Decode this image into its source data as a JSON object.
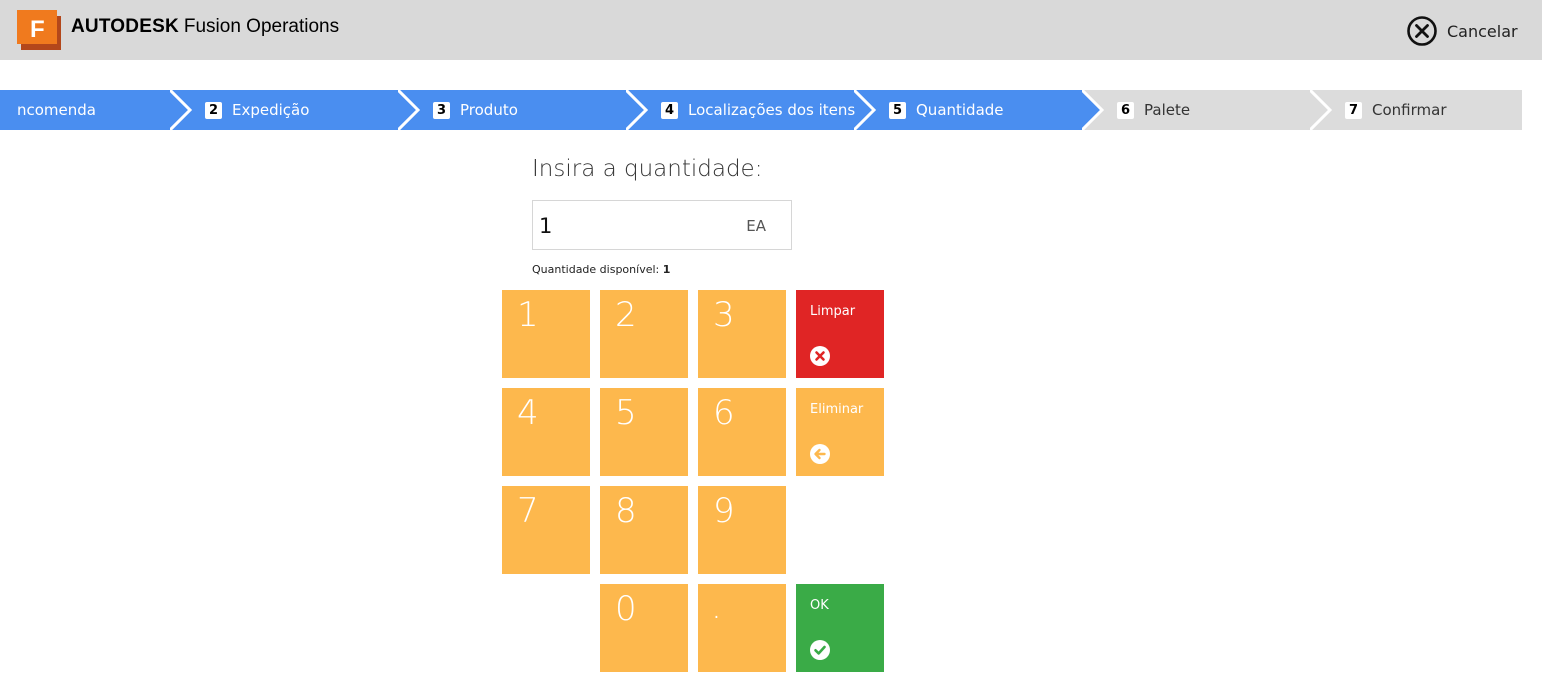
{
  "app": {
    "brand_strong": "AUTODESK",
    "brand_light": "Fusion Operations",
    "cancel_label": "Cancelar"
  },
  "steps": [
    {
      "num": "",
      "label": "ncomenda",
      "state": "active"
    },
    {
      "num": "2",
      "label": "Expedição",
      "state": "active"
    },
    {
      "num": "3",
      "label": "Produto",
      "state": "active"
    },
    {
      "num": "4",
      "label": "Localizações dos itens",
      "state": "active"
    },
    {
      "num": "5",
      "label": "Quantidade",
      "state": "active"
    },
    {
      "num": "6",
      "label": "Palete",
      "state": "inactive"
    },
    {
      "num": "7",
      "label": "Confirmar",
      "state": "inactive"
    }
  ],
  "quantity": {
    "prompt": "Insira a quantidade:",
    "value": "1",
    "unit": "EA",
    "available_label": "Quantidade disponível:",
    "available_value": "1"
  },
  "keypad": {
    "digits": [
      "1",
      "2",
      "3",
      "4",
      "5",
      "6",
      "7",
      "8",
      "9",
      "0",
      "."
    ],
    "clear_label": "Limpar",
    "delete_label": "Eliminar",
    "ok_label": "OK"
  },
  "colors": {
    "header_bg": "#d9d9d9",
    "step_active": "#4a8ef0",
    "step_inactive": "#dcdcdc",
    "key_orange": "#fdb84d",
    "key_red": "#e02525",
    "key_green": "#3aab47"
  },
  "icons": {
    "logo": "autodesk-fusion-logo",
    "cancel": "circle-x-icon",
    "clear": "circle-x-icon",
    "delete": "circle-arrow-left-icon",
    "ok": "circle-check-icon"
  }
}
